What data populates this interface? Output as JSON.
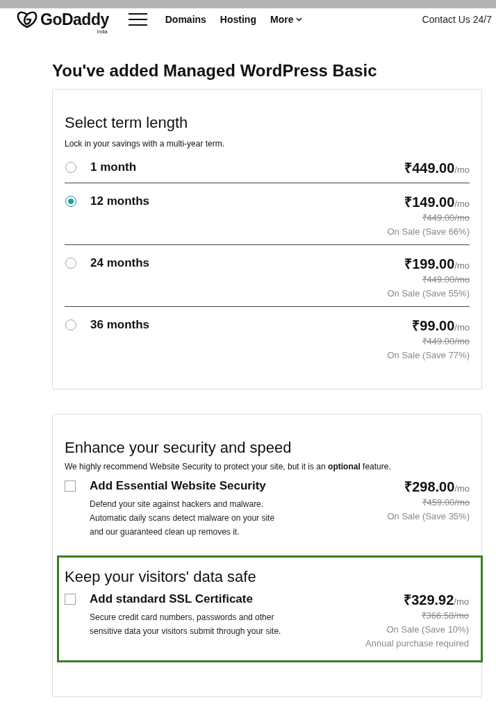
{
  "header": {
    "brand": "GoDaddy",
    "region": "India",
    "nav": [
      {
        "label": "Domains",
        "dropdown": false
      },
      {
        "label": "Hosting",
        "dropdown": false
      },
      {
        "label": "More",
        "dropdown": true
      }
    ],
    "contact": "Contact Us 24/7"
  },
  "page_title": "You've added Managed WordPress Basic",
  "term": {
    "title": "Select term length",
    "subtitle": "Lock in your savings with a multi-year term.",
    "options": [
      {
        "label": "1 month",
        "selected": false,
        "price": "₹449.00",
        "unit": "/mo"
      },
      {
        "label": "12 months",
        "selected": true,
        "price": "₹149.00",
        "unit": "/mo",
        "old_price": "₹449.00/mo",
        "sale": "On Sale (Save 66%)"
      },
      {
        "label": "24 months",
        "selected": false,
        "price": "₹199.00",
        "unit": "/mo",
        "old_price": "₹449.00/mo",
        "sale": "On Sale (Save 55%)"
      },
      {
        "label": "36 months",
        "selected": false,
        "price": "₹99.00",
        "unit": "/mo",
        "old_price": "₹449.00/mo",
        "sale": "On Sale (Save 77%)"
      }
    ]
  },
  "addons": {
    "title": "Enhance your security and speed",
    "subtitle": "We highly recommend Website Security to protect your site, but it is an **optional** feature.",
    "sections": [
      {
        "highlighted": false,
        "items": [
          {
            "label": "Add Essential Website Security",
            "checked": false,
            "description": [
              "Defend your site against hackers and malware.",
              "Automatic daily scans detect malware on your site",
              "and our guaranteed clean up removes it."
            ],
            "price": "₹298.00",
            "unit": "/mo",
            "old_price": "₹459.00/mo",
            "sale": "On Sale (Save 35%)"
          }
        ]
      },
      {
        "highlighted": true,
        "title": "Keep your visitors' data safe",
        "items": [
          {
            "label": "Add standard SSL Certificate",
            "checked": false,
            "description": [
              "Secure credit card numbers, passwords and other",
              "sensitive data your visitors submit through your site."
            ],
            "price": "₹329.92",
            "unit": "/mo",
            "old_price": "₹366.58/mo",
            "sale": "On Sale (Save 10%)",
            "note": "Annual purchase required"
          }
        ]
      }
    ]
  }
}
